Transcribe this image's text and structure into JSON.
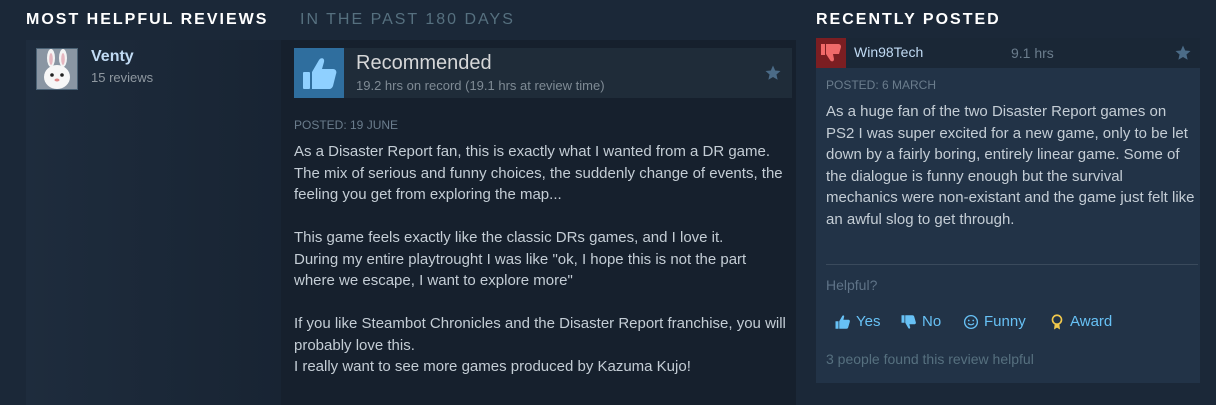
{
  "header": {
    "title": "MOST HELPFUL REVIEWS",
    "subtitle": "IN THE PAST 180 DAYS",
    "right_title": "RECENTLY POSTED"
  },
  "left_review": {
    "author": {
      "name": "Venty",
      "reviews": "15 reviews"
    },
    "vote": {
      "title": "Recommended",
      "hours": "19.2 hrs on record (19.1 hrs at review time)"
    },
    "posted": "POSTED: 19 JUNE",
    "paragraphs": [
      "As a Disaster Report fan, this is exactly what I wanted from a DR game.",
      "The mix of serious and funny choices, the suddenly change of events, the feeling you get from exploring the map...",
      "",
      "This game feels exactly like the classic DRs games, and I love it.",
      "During my entire playtrought I was like \"ok, I hope this is not the part where we escape, I want to explore more\"",
      "",
      "If you like Steambot Chronicles and the Disaster Report franchise, you will probably love this.",
      "I really want to see more games produced by Kazuma Kujo!"
    ]
  },
  "right_review": {
    "author": "Win98Tech",
    "hours": "9.1 hrs",
    "posted": "POSTED: 6 MARCH",
    "text": "As a huge fan of the two Disaster Report games on PS2 I was super excited for a new game, only to be let down by a fairly boring, entirely linear game. Some of the dialogue is funny enough but the survival mechanics were non-existant and the game just felt like an awful slog to get through.",
    "helpful_question": "Helpful?",
    "buttons": {
      "yes": "Yes",
      "no": "No",
      "funny": "Funny",
      "award": "Award"
    },
    "found": "3 people found this review helpful"
  },
  "colors": {
    "background": "#1b2838",
    "recommended": "#2f6e9e",
    "not_recommended": "#7b1e22",
    "link": "#67c1f5"
  }
}
